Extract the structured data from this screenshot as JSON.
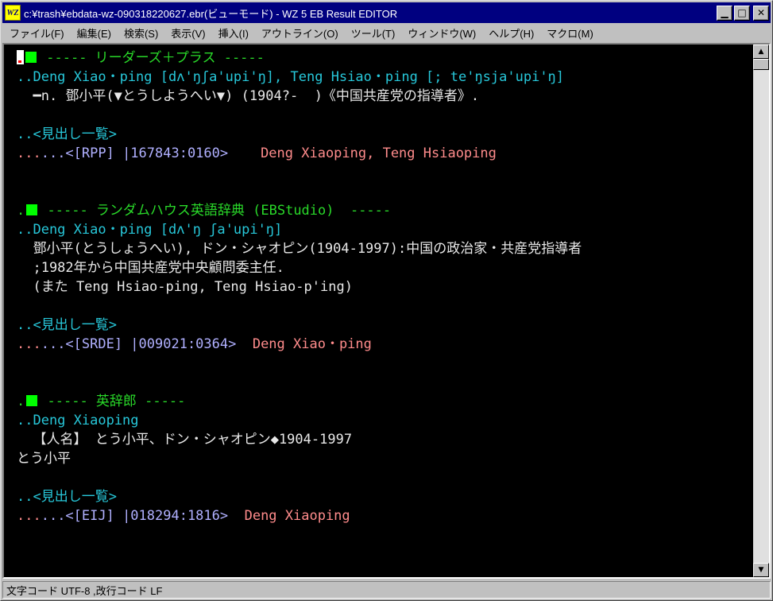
{
  "window": {
    "icon_text": "WZ",
    "title": "c:¥trash¥ebdata-wz-090318220627.ebr(ビューモード) - WZ 5 EB Result EDITOR"
  },
  "menu": [
    "ファイル(F)",
    "編集(E)",
    "検索(S)",
    "表示(V)",
    "挿入(I)",
    "アウトライン(O)",
    "ツール(T)",
    "ウィンドウ(W)",
    "ヘルプ(H)",
    "マクロ(M)"
  ],
  "content": {
    "sec1_header": "----- リーダーズ＋プラス -----",
    "sec1_head": "..Deng Xiao・ping [dʌ'ŋʃa'upi'ŋ], Teng Hsiao・ping [; te'ŋsja'upi'ŋ]",
    "sec1_def": "  ━n. 鄧小平(▼とうしようへい▼) (1904?-  )《中国共産党の指導者》.",
    "sec1_list": "..<見出し一覧>",
    "sec1_ref": "...<[RPP] |167843:0160>",
    "sec1_ref_word": "    Deng Xiaoping, Teng Hsiaoping",
    "sec2_header": "----- ランダムハウス英語辞典 (EBStudio)  -----",
    "sec2_head": "..Deng Xiao・ping [dʌ'ŋ ʃa'upi'ŋ]",
    "sec2_def1": "  鄧小平(とうしょうへい), ドン・シャオピン(1904-1997):中国の政治家・共産党指導者",
    "sec2_def2": "  ;1982年から中国共産党中央顧問委主任.",
    "sec2_def3": "  (また Teng Hsiao-ping, Teng Hsiao-p'ing)",
    "sec2_list": "..<見出し一覧>",
    "sec2_ref": "...<[SRDE] |009021:0364>",
    "sec2_ref_word": "  Deng Xiao・ping",
    "sec3_header": "----- 英辞郎 -----",
    "sec3_head": "..Deng Xiaoping",
    "sec3_def1": "  【人名】 とう小平、ドン・シャオピン◆1904-1997",
    "sec3_def2": "とう小平",
    "sec3_list": "..<見出し一覧>",
    "sec3_ref": "...<[EIJ] |018294:1816>",
    "sec3_ref_word": "  Deng Xiaoping"
  },
  "status": {
    "text": "文字コード UTF-8 ,改行コード LF"
  }
}
